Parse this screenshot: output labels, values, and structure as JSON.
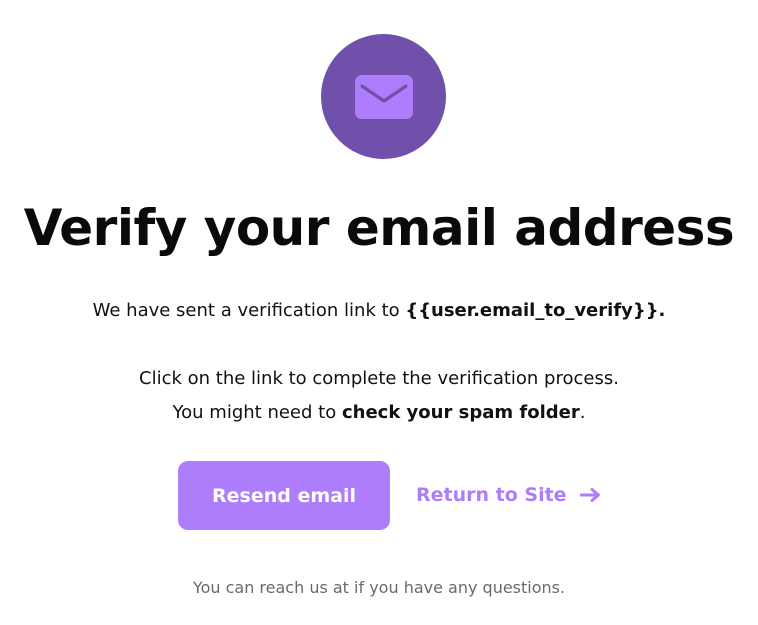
{
  "header": {
    "icon": "envelope-icon",
    "title": "Verify your email address"
  },
  "message": {
    "line1_prefix": "We have sent a verification link to ",
    "line1_email": "{{user.email_to_verify}}",
    "line1_suffix": ".",
    "line2": "Click on the link to complete the verification process.",
    "line3_prefix": "You might need to ",
    "line3_bold": "check your spam folder",
    "line3_suffix": "."
  },
  "actions": {
    "resend_label": "Resend email",
    "return_label": "Return to Site",
    "return_icon": "arrow-right-icon"
  },
  "footer": {
    "text": "You can reach us at if you have any questions."
  },
  "colors": {
    "icon_circle": "#7150ab",
    "accent": "#ad7dfb",
    "text": "#111111",
    "muted": "#6a6a6a"
  }
}
